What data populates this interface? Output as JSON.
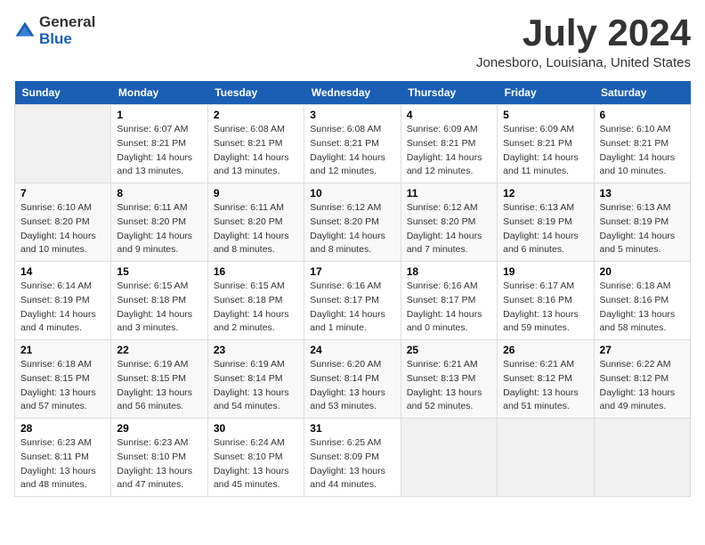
{
  "logo": {
    "general": "General",
    "blue": "Blue"
  },
  "title": "July 2024",
  "subtitle": "Jonesboro, Louisiana, United States",
  "days_header": [
    "Sunday",
    "Monday",
    "Tuesday",
    "Wednesday",
    "Thursday",
    "Friday",
    "Saturday"
  ],
  "weeks": [
    [
      {
        "day": "",
        "info": ""
      },
      {
        "day": "1",
        "info": "Sunrise: 6:07 AM\nSunset: 8:21 PM\nDaylight: 14 hours\nand 13 minutes."
      },
      {
        "day": "2",
        "info": "Sunrise: 6:08 AM\nSunset: 8:21 PM\nDaylight: 14 hours\nand 13 minutes."
      },
      {
        "day": "3",
        "info": "Sunrise: 6:08 AM\nSunset: 8:21 PM\nDaylight: 14 hours\nand 12 minutes."
      },
      {
        "day": "4",
        "info": "Sunrise: 6:09 AM\nSunset: 8:21 PM\nDaylight: 14 hours\nand 12 minutes."
      },
      {
        "day": "5",
        "info": "Sunrise: 6:09 AM\nSunset: 8:21 PM\nDaylight: 14 hours\nand 11 minutes."
      },
      {
        "day": "6",
        "info": "Sunrise: 6:10 AM\nSunset: 8:21 PM\nDaylight: 14 hours\nand 10 minutes."
      }
    ],
    [
      {
        "day": "7",
        "info": "Sunrise: 6:10 AM\nSunset: 8:20 PM\nDaylight: 14 hours\nand 10 minutes."
      },
      {
        "day": "8",
        "info": "Sunrise: 6:11 AM\nSunset: 8:20 PM\nDaylight: 14 hours\nand 9 minutes."
      },
      {
        "day": "9",
        "info": "Sunrise: 6:11 AM\nSunset: 8:20 PM\nDaylight: 14 hours\nand 8 minutes."
      },
      {
        "day": "10",
        "info": "Sunrise: 6:12 AM\nSunset: 8:20 PM\nDaylight: 14 hours\nand 8 minutes."
      },
      {
        "day": "11",
        "info": "Sunrise: 6:12 AM\nSunset: 8:20 PM\nDaylight: 14 hours\nand 7 minutes."
      },
      {
        "day": "12",
        "info": "Sunrise: 6:13 AM\nSunset: 8:19 PM\nDaylight: 14 hours\nand 6 minutes."
      },
      {
        "day": "13",
        "info": "Sunrise: 6:13 AM\nSunset: 8:19 PM\nDaylight: 14 hours\nand 5 minutes."
      }
    ],
    [
      {
        "day": "14",
        "info": "Sunrise: 6:14 AM\nSunset: 8:19 PM\nDaylight: 14 hours\nand 4 minutes."
      },
      {
        "day": "15",
        "info": "Sunrise: 6:15 AM\nSunset: 8:18 PM\nDaylight: 14 hours\nand 3 minutes."
      },
      {
        "day": "16",
        "info": "Sunrise: 6:15 AM\nSunset: 8:18 PM\nDaylight: 14 hours\nand 2 minutes."
      },
      {
        "day": "17",
        "info": "Sunrise: 6:16 AM\nSunset: 8:17 PM\nDaylight: 14 hours\nand 1 minute."
      },
      {
        "day": "18",
        "info": "Sunrise: 6:16 AM\nSunset: 8:17 PM\nDaylight: 14 hours\nand 0 minutes."
      },
      {
        "day": "19",
        "info": "Sunrise: 6:17 AM\nSunset: 8:16 PM\nDaylight: 13 hours\nand 59 minutes."
      },
      {
        "day": "20",
        "info": "Sunrise: 6:18 AM\nSunset: 8:16 PM\nDaylight: 13 hours\nand 58 minutes."
      }
    ],
    [
      {
        "day": "21",
        "info": "Sunrise: 6:18 AM\nSunset: 8:15 PM\nDaylight: 13 hours\nand 57 minutes."
      },
      {
        "day": "22",
        "info": "Sunrise: 6:19 AM\nSunset: 8:15 PM\nDaylight: 13 hours\nand 56 minutes."
      },
      {
        "day": "23",
        "info": "Sunrise: 6:19 AM\nSunset: 8:14 PM\nDaylight: 13 hours\nand 54 minutes."
      },
      {
        "day": "24",
        "info": "Sunrise: 6:20 AM\nSunset: 8:14 PM\nDaylight: 13 hours\nand 53 minutes."
      },
      {
        "day": "25",
        "info": "Sunrise: 6:21 AM\nSunset: 8:13 PM\nDaylight: 13 hours\nand 52 minutes."
      },
      {
        "day": "26",
        "info": "Sunrise: 6:21 AM\nSunset: 8:12 PM\nDaylight: 13 hours\nand 51 minutes."
      },
      {
        "day": "27",
        "info": "Sunrise: 6:22 AM\nSunset: 8:12 PM\nDaylight: 13 hours\nand 49 minutes."
      }
    ],
    [
      {
        "day": "28",
        "info": "Sunrise: 6:23 AM\nSunset: 8:11 PM\nDaylight: 13 hours\nand 48 minutes."
      },
      {
        "day": "29",
        "info": "Sunrise: 6:23 AM\nSunset: 8:10 PM\nDaylight: 13 hours\nand 47 minutes."
      },
      {
        "day": "30",
        "info": "Sunrise: 6:24 AM\nSunset: 8:10 PM\nDaylight: 13 hours\nand 45 minutes."
      },
      {
        "day": "31",
        "info": "Sunrise: 6:25 AM\nSunset: 8:09 PM\nDaylight: 13 hours\nand 44 minutes."
      },
      {
        "day": "",
        "info": ""
      },
      {
        "day": "",
        "info": ""
      },
      {
        "day": "",
        "info": ""
      }
    ]
  ]
}
